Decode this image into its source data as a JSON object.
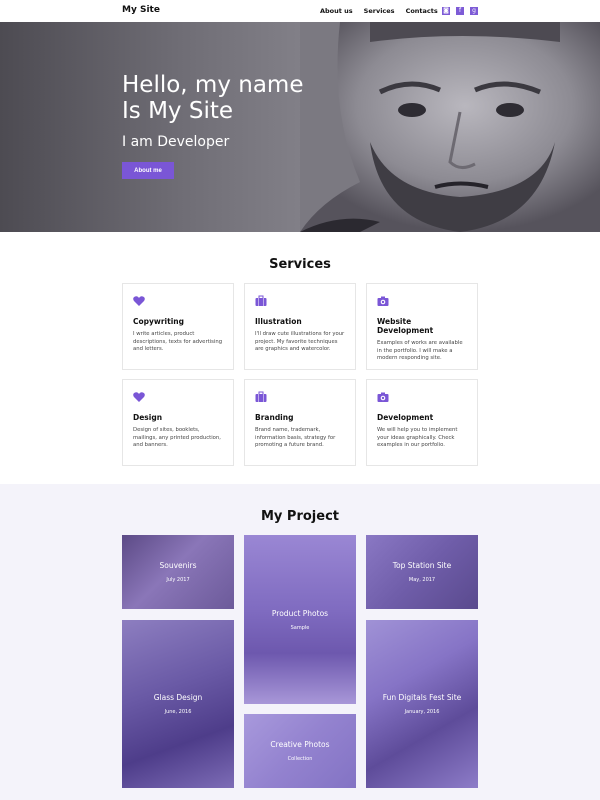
{
  "nav": {
    "brand": "My Site",
    "links": [
      "About us",
      "Services",
      "Contacts"
    ],
    "social": [
      "instagram-icon",
      "facebook-icon",
      "googleplus-icon"
    ]
  },
  "hero": {
    "title_line1": "Hello, my name",
    "title_line2": "Is My Site",
    "subtitle": "I am Developer",
    "button": "About me"
  },
  "services": {
    "title": "Services",
    "items": [
      {
        "icon": "heart-icon",
        "title": "Copywriting",
        "text": "I write articles, product descriptions, texts for advertising and letters."
      },
      {
        "icon": "briefcase-icon",
        "title": "Illustration",
        "text": "I'll draw cute illustrations for your project. My favorite techniques are graphics and watercolor."
      },
      {
        "icon": "camera-icon",
        "title": "Website Development",
        "text": "Examples of works are available in the portfolio. I will make a modern responding site."
      },
      {
        "icon": "heart-icon",
        "title": "Design",
        "text": "Design of sites, booklets, mailings, any printed production, and banners."
      },
      {
        "icon": "briefcase-icon",
        "title": "Branding",
        "text": "Brand name, trademark, information basis, strategy for promoting a future brand."
      },
      {
        "icon": "camera-icon",
        "title": "Development",
        "text": "We will help you to implement your ideas graphically. Check examples in our portfolio."
      }
    ]
  },
  "projects": {
    "title": "My Project",
    "items": [
      {
        "title": "Souvenirs",
        "date": "July 2017"
      },
      {
        "title": "Product Photos",
        "date": "Sample"
      },
      {
        "title": "Top Station Site",
        "date": "May, 2017"
      },
      {
        "title": "Glass Design",
        "date": "June, 2016"
      },
      {
        "title": "Fun Digitals Fest Site",
        "date": "January, 2016"
      },
      {
        "title": "Creative Photos",
        "date": "Collection"
      }
    ]
  },
  "colors": {
    "accent": "#7a56d6",
    "project_bg": "#f4f3fa"
  }
}
